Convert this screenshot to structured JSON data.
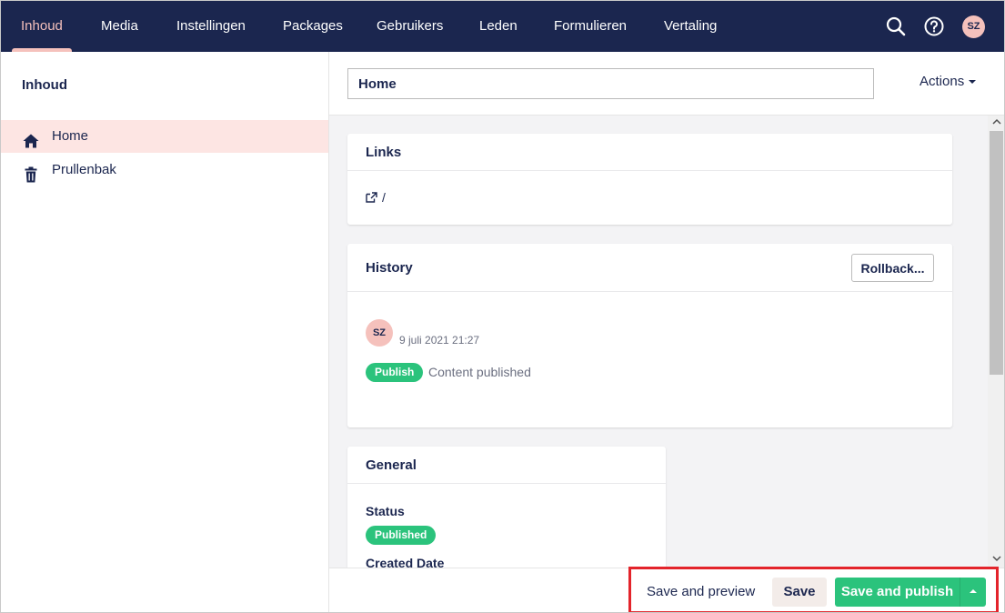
{
  "nav": {
    "items": [
      {
        "label": "Inhoud",
        "active": true
      },
      {
        "label": "Media"
      },
      {
        "label": "Instellingen"
      },
      {
        "label": "Packages"
      },
      {
        "label": "Gebruikers"
      },
      {
        "label": "Leden"
      },
      {
        "label": "Formulieren"
      },
      {
        "label": "Vertaling"
      }
    ],
    "user_initials": "SZ",
    "icons": [
      "search-icon",
      "help-icon"
    ]
  },
  "sidebar": {
    "title": "Inhoud",
    "items": [
      {
        "label": "Home",
        "icon": "home-icon",
        "selected": true
      },
      {
        "label": "Prullenbak",
        "icon": "trash-icon"
      }
    ]
  },
  "editor": {
    "name_value": "Home",
    "actions_label": "Actions"
  },
  "links": {
    "title": "Links",
    "url": "/"
  },
  "history": {
    "title": "History",
    "rollback_label": "Rollback...",
    "entries": [
      {
        "initials": "SZ",
        "date": "9 juli 2021 21:27",
        "badge": "Publish",
        "text": "Content published"
      }
    ]
  },
  "general": {
    "title": "General",
    "status_label": "Status",
    "status_value": "Published",
    "created_label": "Created Date"
  },
  "footer": {
    "preview_label": "Save and preview",
    "save_label": "Save",
    "publish_label": "Save and publish"
  },
  "colors": {
    "nav_bg": "#1b264f",
    "accent_pink": "#f5c1bc",
    "success_green": "#2bc37c",
    "highlight_red": "#e3242b"
  }
}
